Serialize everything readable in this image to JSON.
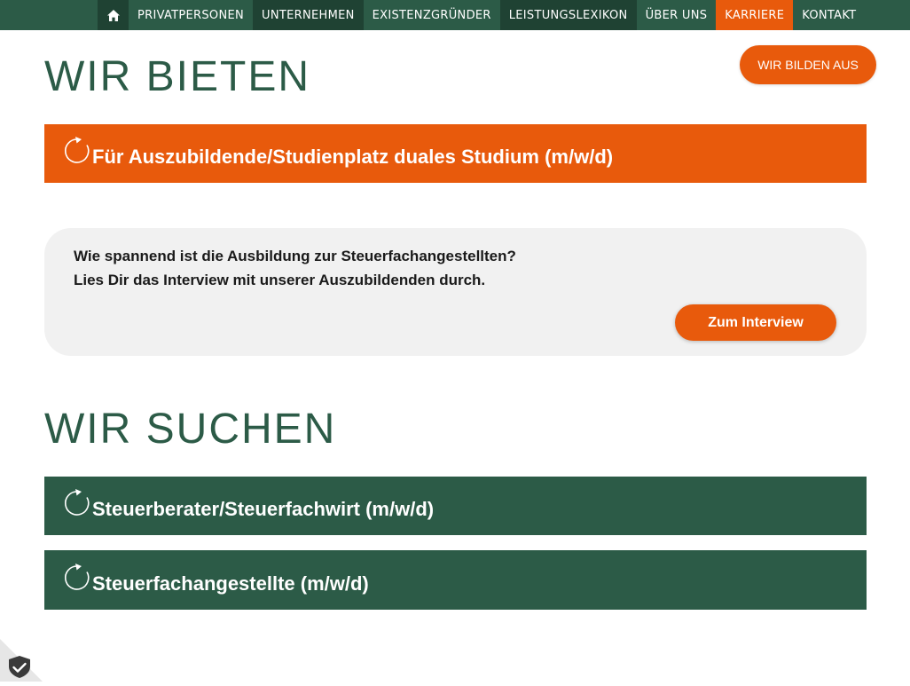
{
  "nav": {
    "home_icon": "home-icon",
    "items": [
      {
        "label": "PRIVATPERSONEN"
      },
      {
        "label": "UNTERNEHMEN"
      },
      {
        "label": "EXISTENZGRÜNDER"
      },
      {
        "label": "LEISTUNGSLEXIKON"
      },
      {
        "label": "ÜBER UNS"
      },
      {
        "label": "KARRIERE"
      },
      {
        "label": "KONTAKT"
      }
    ]
  },
  "colors": {
    "green": "#2c5b47",
    "green_dark": "#1f4233",
    "orange": "#e85a0c",
    "card_bg": "#f1f1f1"
  },
  "offer_section": {
    "heading": "WIR BIETEN",
    "cta_label": "WIR BILDEN AUS",
    "accordion": {
      "title": "Für Auszubildende/Studienplatz duales Studium (m/w/d)",
      "icon": "refresh-icon"
    }
  },
  "interview_card": {
    "line1": "Wie spannend ist die Ausbildung zur Steuerfachangestellten?",
    "line2": "Lies Dir das Interview mit unserer Auszubildenden durch.",
    "button_label": "Zum Interview"
  },
  "search_section": {
    "heading": "WIR SUCHEN",
    "accordions": [
      {
        "title": "Steuerberater/Steuerfachwirt (m/w/d)",
        "icon": "refresh-icon"
      },
      {
        "title": "Steuerfachangestellte (m/w/d)",
        "icon": "refresh-icon"
      }
    ]
  },
  "privacy_badge": {
    "icon": "shield-check-icon"
  }
}
